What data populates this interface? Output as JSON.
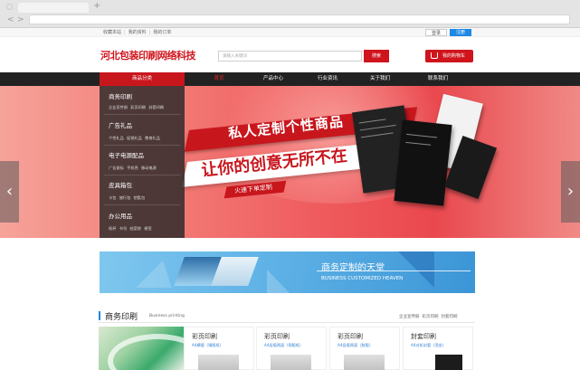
{
  "toplinks": [
    "收藏本站",
    "我的资料",
    "我的订单"
  ],
  "auth": {
    "login": "登录",
    "register": "注册"
  },
  "logo": "河北包装印刷网络科技",
  "search": {
    "placeholder": "请输入关键词",
    "button": "搜索"
  },
  "cart": {
    "label": "我的购物车"
  },
  "nav": {
    "category": "商品分类",
    "items": [
      {
        "label": "首页",
        "active": true
      },
      {
        "label": "产品中心",
        "active": false
      },
      {
        "label": "行业资讯",
        "active": false
      },
      {
        "label": "关于我们",
        "active": false
      },
      {
        "label": "联系我们",
        "active": false
      }
    ]
  },
  "side_menu": [
    {
      "title": "商务印刷",
      "subs": "企业宣传册  彩页印刷  封套印刷"
    },
    {
      "title": "广告礼品",
      "subs": "个性礼品  促销礼品  教育礼品"
    },
    {
      "title": "电子电源配品",
      "subs": "广告鼠标  手机壳  移动电源"
    },
    {
      "title": "皮具箱包",
      "subs": "卡包  旅行包  钥匙包"
    },
    {
      "title": "办公用品",
      "subs": "纸杯  书刊  档案袋  便签"
    }
  ],
  "banner": {
    "line1": "私人定制个性商品",
    "line2": "让你的创意无所不在",
    "line3": "火速下单定制",
    "prev_arrow": "‹",
    "next_arrow": "›"
  },
  "blue_banner": {
    "title": "商务定制的天堂",
    "subtitle": "BUSINESS CUSTOMIZED HEAVEN"
  },
  "section": {
    "title": "商务印刷",
    "subtitle_en": "Business printing",
    "links": [
      "企业宣传册",
      "彩页印刷",
      "封套印刷"
    ]
  },
  "products": [
    {
      "title": "彩页印刷",
      "spec": "A4横版（铜版纸）"
    },
    {
      "title": "彩页印刷",
      "spec": "A4竖版两面（铜版纸）"
    },
    {
      "title": "彩页印刷",
      "spec": "A4竖版两面（胶版）"
    },
    {
      "title": "封套印刷",
      "spec": "A4对折封套（烫金）"
    }
  ],
  "colors": {
    "brand_red": "#d0141c",
    "nav_dark": "#222222",
    "accent_blue": "#1e88e5"
  }
}
